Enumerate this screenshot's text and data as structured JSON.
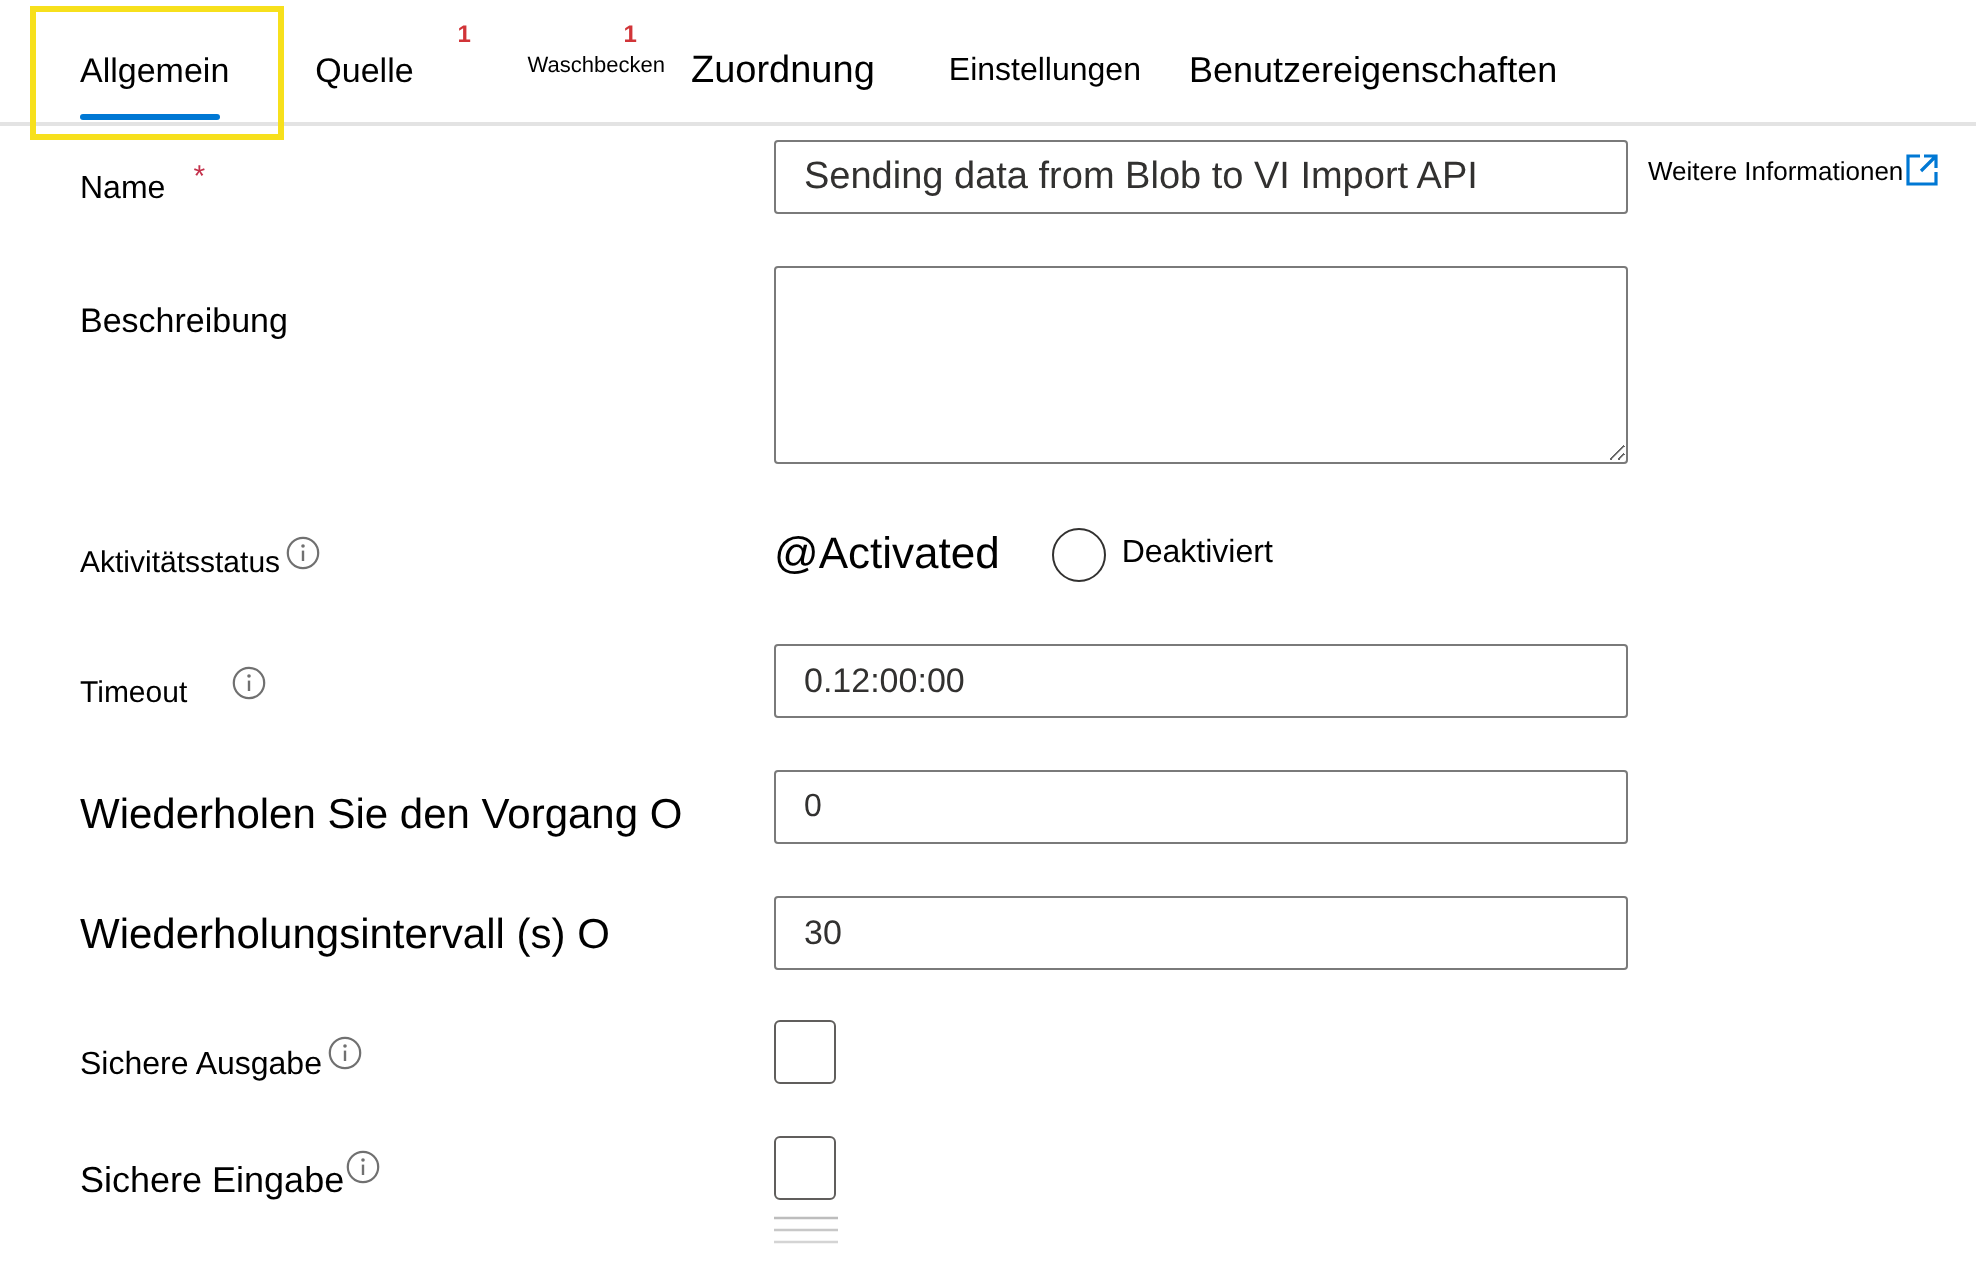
{
  "tabs": [
    {
      "label": "Allgemein",
      "selected": true,
      "highlighted": true
    },
    {
      "label": "Quelle",
      "selected": false,
      "highlighted": false,
      "badge": "1"
    },
    {
      "label": "Waschbecken",
      "selected": false,
      "highlighted": false,
      "badge": "1"
    },
    {
      "label": "Zuordnung",
      "selected": false,
      "highlighted": false
    },
    {
      "label": "Einstellungen",
      "selected": false,
      "highlighted": false
    },
    {
      "label": "Benutzereigenschaften",
      "selected": false,
      "highlighted": false
    }
  ],
  "fields": [
    {
      "kind": "text",
      "label": "Name",
      "required_mark": "*",
      "info": false,
      "value": "Sending data from Blob to VI Import API",
      "link": "Weitere Informationen"
    },
    {
      "kind": "textarea",
      "label": "Beschreibung",
      "info": false
    },
    {
      "kind": "radio",
      "label": "Aktivitätsstatus",
      "info": true,
      "value": "@Activated",
      "option": {
        "label": "Deaktiviert",
        "selected": false
      }
    },
    {
      "kind": "text",
      "label": "Timeout",
      "info": true,
      "value": "0.12:00:00"
    },
    {
      "kind": "text",
      "label": "Wiederholen Sie den Vorgang O",
      "info": false,
      "value": "0"
    },
    {
      "kind": "text",
      "label": "Wiederholungsintervall (s) O",
      "info": false,
      "value": "30"
    },
    {
      "kind": "checkbox",
      "label": "Sichere Ausgabe",
      "info": true,
      "checked": false
    },
    {
      "kind": "checkbox",
      "label": "Sichere Eingabe",
      "info": true,
      "checked": false
    }
  ]
}
